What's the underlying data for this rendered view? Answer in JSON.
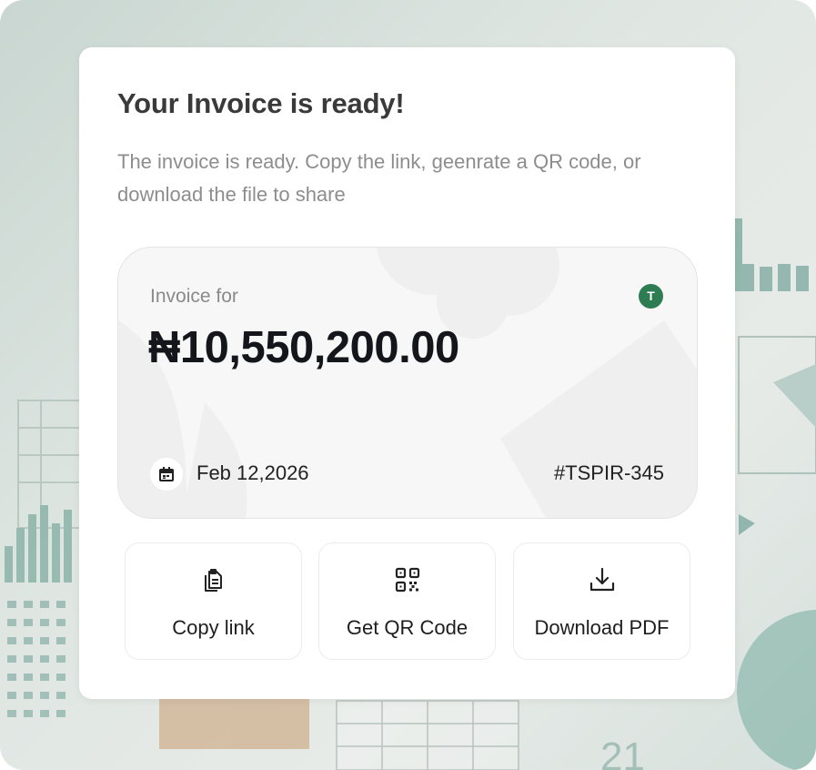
{
  "dialog": {
    "title": "Your Invoice is ready!",
    "subtitle": "The invoice is ready. Copy the link, geenrate a QR code, or download the file to share"
  },
  "invoice": {
    "label": "Invoice for",
    "avatar_initial": "T",
    "amount": "₦10,550,200.00",
    "date": "Feb 12,2026",
    "id": "#TSPIR-345"
  },
  "actions": [
    {
      "label": "Copy link",
      "icon": "copy-clipboard-icon"
    },
    {
      "label": "Get QR Code",
      "icon": "qr-code-icon"
    },
    {
      "label": "Download PDF",
      "icon": "download-icon"
    }
  ],
  "colors": {
    "avatar": "#2e7d52",
    "amount_text": "#15161c",
    "subtitle_text": "#8d8d8d"
  }
}
